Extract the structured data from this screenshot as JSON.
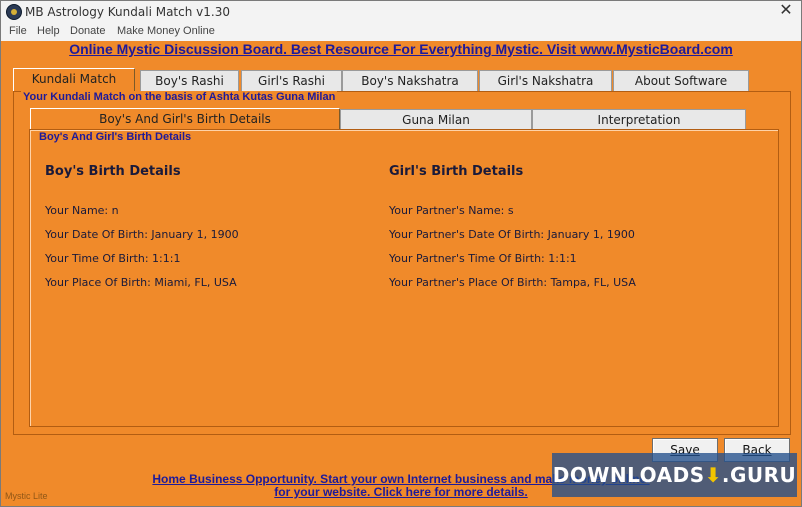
{
  "window": {
    "title": "MB Astrology Kundali Match v1.30"
  },
  "menu": {
    "items": [
      "File",
      "Help",
      "Donate",
      "Make Money Online"
    ]
  },
  "banner_top": "Online Mystic Discussion Board. Best Resource For Everything Mystic. Visit www.MysticBoard.com",
  "tabs": [
    "Kundali Match",
    "Boy's Rashi",
    "Girl's Rashi",
    "Boy's Nakshatra",
    "Girl's Nakshatra",
    "About Software"
  ],
  "group_title": "Your Kundali Match on the basis of Ashta Kutas Guna Milan",
  "subtabs": [
    "Boy's And Girl's Birth Details",
    "Guna Milan",
    "Interpretation"
  ],
  "inner_title": "Boy's And Girl's Birth Details",
  "boy": {
    "heading": "Boy's Birth Details",
    "name": "Your Name: n",
    "dob": "Your Date Of Birth: January 1, 1900",
    "tob": "Your Time Of Birth: 1:1:1",
    "pob": "Your Place Of Birth: Miami, FL, USA"
  },
  "girl": {
    "heading": "Girl's Birth Details",
    "name": "Your Partner's Name: s",
    "dob": "Your Partner's Date Of Birth: January 1, 1900",
    "tob": "Your Partner's Time Of Birth: 1:1:1",
    "pob": "Your Partner's Place Of Birth: Tampa, FL, USA"
  },
  "buttons": {
    "save": "Save",
    "back": "Back"
  },
  "footer": {
    "line1": "Home Business Opportunity. Start your own Internet business and make money online.",
    "line2": "for your website. Click here for more details."
  },
  "watermark": {
    "text": "DOWNLOADS",
    "suffix": ".GURU",
    "icon": "download-arrow-icon"
  },
  "corner_mark": "Mystic Lite"
}
